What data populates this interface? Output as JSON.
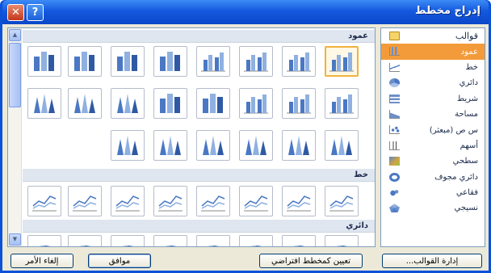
{
  "window": {
    "title": "إدراج مخطط",
    "help_label": "?",
    "close_label": "✕"
  },
  "categories": [
    {
      "label": "قوالب",
      "icon": "folder-icon"
    },
    {
      "label": "عمود",
      "icon": "column-chart-icon"
    },
    {
      "label": "خط",
      "icon": "line-chart-icon"
    },
    {
      "label": "دائري",
      "icon": "pie-chart-icon"
    },
    {
      "label": "شريط",
      "icon": "bar-chart-icon"
    },
    {
      "label": "مساحة",
      "icon": "area-chart-icon"
    },
    {
      "label": "س ص (مبعثر)",
      "icon": "scatter-chart-icon"
    },
    {
      "label": "أسهم",
      "icon": "stock-chart-icon"
    },
    {
      "label": "سطحي",
      "icon": "surface-chart-icon"
    },
    {
      "label": "دائري مجوف",
      "icon": "doughnut-chart-icon"
    },
    {
      "label": "فقاعي",
      "icon": "bubble-chart-icon"
    },
    {
      "label": "نسيجي",
      "icon": "radar-chart-icon"
    }
  ],
  "selected_category": "عمود",
  "gallery": {
    "sections": [
      {
        "label": "عمود"
      },
      {
        "label": "خط"
      },
      {
        "label": "دائري"
      }
    ]
  },
  "buttons": {
    "manage_templates": "إدارة القوالب...",
    "set_default": "تعيين كمخطط افتراضي",
    "ok": "موافق",
    "cancel": "إلغاء الأمر"
  },
  "colors": {
    "title_bar": "#0b52d8",
    "selection": "#f39b3a",
    "dialog_bg": "#ece9d8",
    "chart_blue": "#4a78c4"
  }
}
